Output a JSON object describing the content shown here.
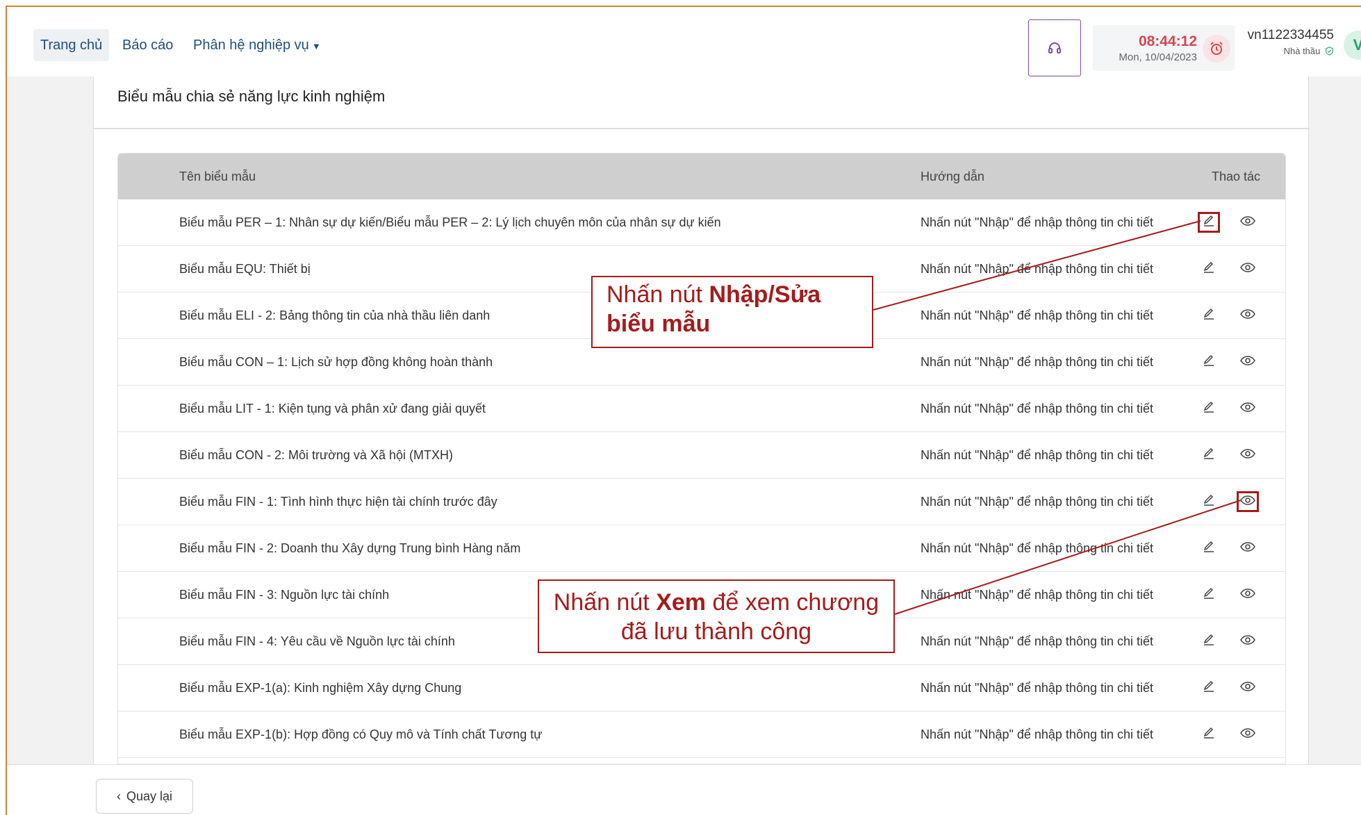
{
  "nav": {
    "home": "Trang chủ",
    "report": "Báo cáo",
    "business": "Phân hệ nghiệp vụ"
  },
  "clock": {
    "time": "08:44:12",
    "date": "Mon, 10/04/2023"
  },
  "user": {
    "id": "vn1122334455",
    "role": "Nhà thầu",
    "avatar": "V"
  },
  "card": {
    "title": "Biểu mẫu chia sẻ năng lực kinh nghiệm"
  },
  "table": {
    "headers": {
      "name": "Tên biểu mẫu",
      "guide": "Hướng dẫn",
      "actions": "Thao tác"
    },
    "rows": [
      {
        "name": "Biểu mẫu PER – 1: Nhân sự dự kiến/Biểu mẫu PER – 2: Lý lịch chuyên môn của nhân sự dự kiến",
        "guide": "Nhấn nút \"Nhập\" để nhập thông tin chi tiết"
      },
      {
        "name": "Biểu mẫu EQU: Thiết bị",
        "guide": "Nhấn nút \"Nhập\" để nhập thông tin chi tiết"
      },
      {
        "name": "Biểu mẫu ELI - 2: Bảng thông tin của nhà thầu liên danh",
        "guide": "Nhấn nút \"Nhập\" để nhập thông tin chi tiết"
      },
      {
        "name": "Biểu mẫu CON – 1: Lịch sử hợp đồng không hoàn thành",
        "guide": "Nhấn nút \"Nhập\" để nhập thông tin chi tiết"
      },
      {
        "name": "Biểu mẫu LIT - 1: Kiện tụng và phân xử đang giải quyết",
        "guide": "Nhấn nút \"Nhập\" để nhập thông tin chi tiết"
      },
      {
        "name": "Biểu mẫu CON - 2: Môi trường và Xã hội (MTXH)",
        "guide": "Nhấn nút \"Nhập\" để nhập thông tin chi tiết"
      },
      {
        "name": "Biểu mẫu FIN - 1: Tình hình thực hiện tài chính trước đây",
        "guide": "Nhấn nút \"Nhập\" để nhập thông tin chi tiết"
      },
      {
        "name": "Biểu mẫu FIN - 2: Doanh thu Xây dựng Trung bình Hàng năm",
        "guide": "Nhấn nút \"Nhập\" để nhập thông tin chi tiết"
      },
      {
        "name": "Biểu mẫu FIN - 3: Nguồn lực tài chính",
        "guide": "Nhấn nút \"Nhập\" để nhập thông tin chi tiết"
      },
      {
        "name": "Biểu mẫu FIN - 4: Yêu cầu về Nguồn lực tài chính",
        "guide": "Nhấn nút \"Nhập\" để nhập thông tin chi tiết"
      },
      {
        "name": "Biểu mẫu EXP-1(a): Kinh nghiệm Xây dựng Chung",
        "guide": "Nhấn nút \"Nhập\" để nhập thông tin chi tiết"
      },
      {
        "name": "Biểu mẫu EXP-1(b): Hợp đồng có Quy mô và Tính chất Tương tự",
        "guide": "Nhấn nút \"Nhập\" để nhập thông tin chi tiết"
      }
    ]
  },
  "footer": {
    "back": "Quay lại"
  },
  "annotations": {
    "edit_prefix": "Nhấn nút ",
    "edit_bold": "Nhập/Sửa biểu mẫu",
    "view_prefix": "Nhấn nút ",
    "view_bold": "Xem",
    "view_suffix": " để xem chương đã lưu thành công"
  },
  "colors": {
    "nav_text": "#1f4e79",
    "clock_time": "#d64550",
    "annotation": "#a31c1c",
    "table_header_bg": "#cfcfcf"
  },
  "icons": {
    "support": "headset-icon",
    "alarm": "alarm-clock-icon",
    "verified": "shield-check-icon",
    "edit": "pencil-icon",
    "view": "eye-icon",
    "back": "chevron-left-icon"
  }
}
